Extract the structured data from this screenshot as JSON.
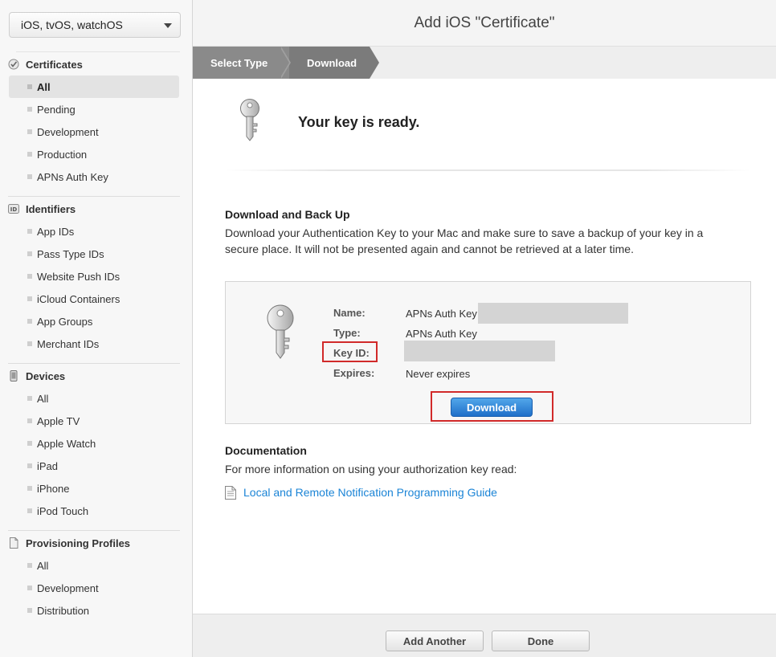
{
  "sidebar": {
    "platform": "iOS, tvOS, watchOS",
    "sections": [
      {
        "title": "Certificates",
        "items": [
          "All",
          "Pending",
          "Development",
          "Production",
          "APNs Auth Key"
        ]
      },
      {
        "title": "Identifiers",
        "icon_text": "ID",
        "items": [
          "App IDs",
          "Pass Type IDs",
          "Website Push IDs",
          "iCloud Containers",
          "App Groups",
          "Merchant IDs"
        ]
      },
      {
        "title": "Devices",
        "items": [
          "All",
          "Apple TV",
          "Apple Watch",
          "iPad",
          "iPhone",
          "iPod Touch"
        ]
      },
      {
        "title": "Provisioning Profiles",
        "items": [
          "All",
          "Development",
          "Distribution"
        ]
      }
    ],
    "active_item": "Certificates/All"
  },
  "main": {
    "title": "Add iOS \"Certificate\"",
    "steps": [
      "Select Type",
      "Download"
    ],
    "ready_message": "Your key is ready.",
    "backup": {
      "heading": "Download and Back Up",
      "text": "Download your Authentication Key to your Mac and make sure to save a backup of your key in a secure place. It will not be presented again and cannot be retrieved at a later time."
    },
    "key": {
      "name_label": "Name:",
      "name_value": "APNs Auth Key",
      "type_label": "Type:",
      "type_value": "APNs Auth Key",
      "keyid_label": "Key ID:",
      "expires_label": "Expires:",
      "expires_value": "Never expires",
      "download_label": "Download"
    },
    "documentation": {
      "heading": "Documentation",
      "text": "For more information on using your authorization key read:",
      "link": "Local and Remote Notification Programming Guide"
    },
    "footer": {
      "add_another": "Add Another",
      "done": "Done"
    }
  },
  "colors": {
    "link": "#1b84d6",
    "button_blue": "#1f6fc9",
    "highlight_red": "#d12a2a"
  }
}
